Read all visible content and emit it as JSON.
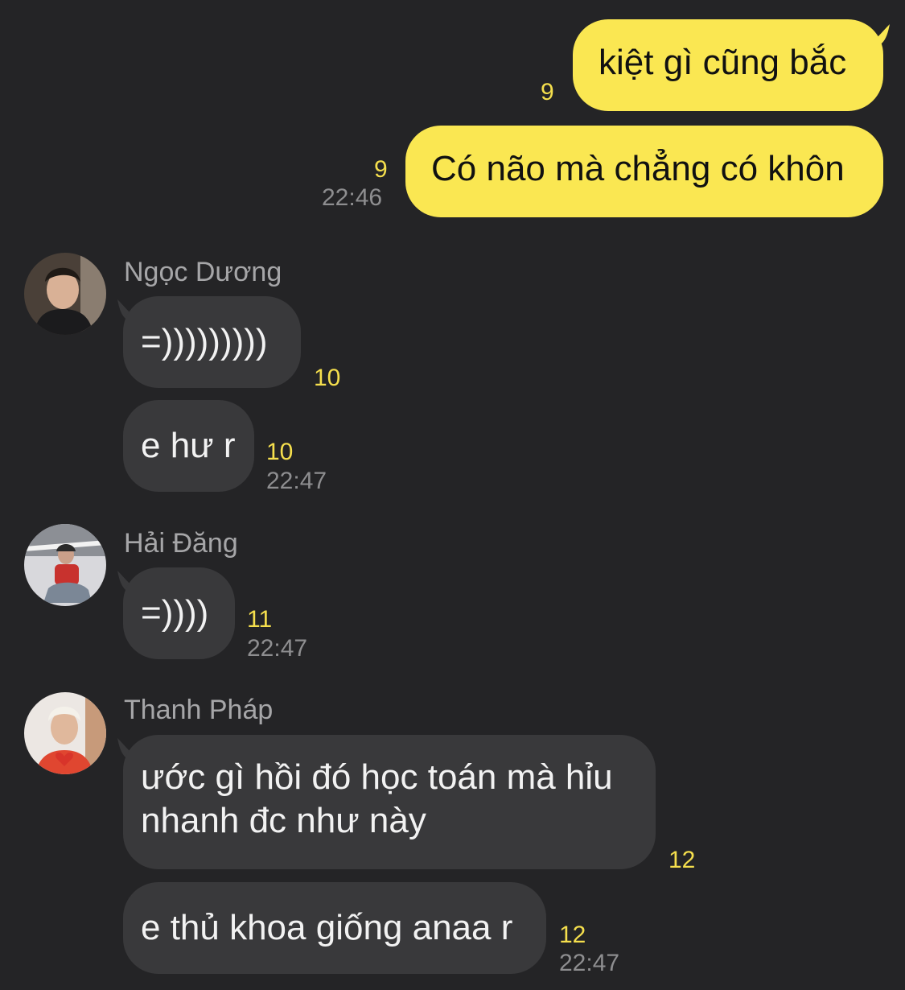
{
  "colors": {
    "background": "#242426",
    "outgoing_bubble": "#fae752",
    "incoming_bubble": "#39393b",
    "unread_count": "#f5df4d",
    "timestamp": "#8e8e90",
    "sender_name": "#a6a6a8"
  },
  "outgoing": [
    {
      "text": "kiệt gì cũng bắc",
      "unread": "9"
    },
    {
      "text": "Có não mà chẳng có khôn",
      "unread": "9",
      "time": "22:46"
    }
  ],
  "group1": {
    "sender": "Ngọc Dương",
    "avatar_icon": "avatar-ngoc-duong",
    "messages": [
      {
        "text": "=)))))))))",
        "unread": "10"
      },
      {
        "text": "e hư r",
        "unread": "10",
        "time": "22:47"
      }
    ]
  },
  "group2": {
    "sender": "Hải Đăng",
    "avatar_icon": "avatar-hai-dang",
    "messages": [
      {
        "text": "=))))",
        "unread": "11",
        "time": "22:47"
      }
    ]
  },
  "group3": {
    "sender": "Thanh Pháp",
    "avatar_icon": "avatar-thanh-phap",
    "messages": [
      {
        "text": "ước gì hồi đó học toán mà hỉu nhanh đc như này",
        "unread": "12"
      },
      {
        "text": "e thủ khoa giống anaa r",
        "unread": "12",
        "time": "22:47"
      }
    ]
  }
}
